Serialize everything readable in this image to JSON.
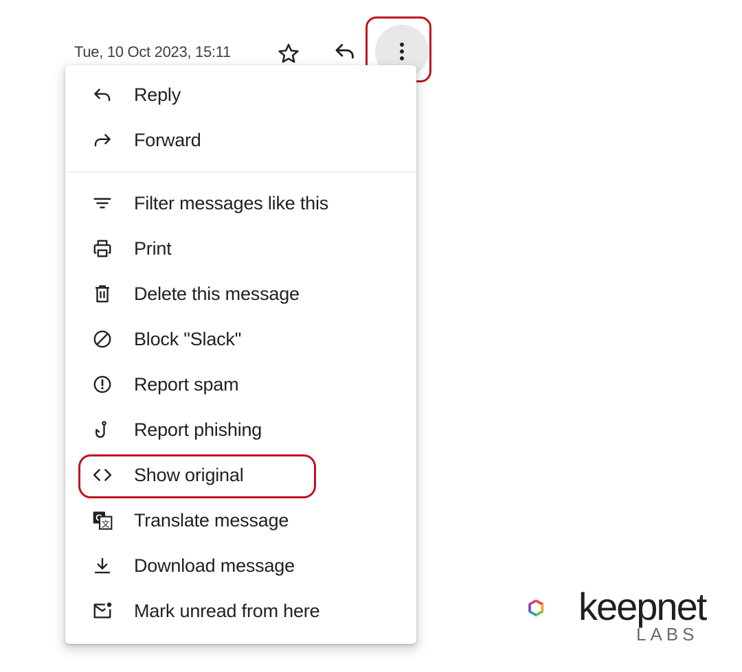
{
  "header": {
    "date": "Tue, 10 Oct 2023, 15:11",
    "star_icon": "star-icon",
    "reply_icon": "reply-icon",
    "more_icon": "more-vert-icon"
  },
  "menu": {
    "items": [
      {
        "label": "Reply",
        "icon": "reply-icon"
      },
      {
        "label": "Forward",
        "icon": "forward-icon"
      },
      {
        "label": "Filter messages like this",
        "icon": "filter-icon"
      },
      {
        "label": "Print",
        "icon": "print-icon"
      },
      {
        "label": "Delete this message",
        "icon": "trash-icon"
      },
      {
        "label": "Block \"Slack\"",
        "icon": "block-icon"
      },
      {
        "label": "Report spam",
        "icon": "report-spam-icon"
      },
      {
        "label": "Report phishing",
        "icon": "phishing-hook-icon"
      },
      {
        "label": "Show original",
        "icon": "code-icon"
      },
      {
        "label": "Translate message",
        "icon": "translate-icon"
      },
      {
        "label": "Download message",
        "icon": "download-icon"
      },
      {
        "label": "Mark unread from here",
        "icon": "mark-unread-icon"
      }
    ]
  },
  "annotation": {
    "highlight_color": "#c0111f"
  },
  "watermark": {
    "brand": "keepnet",
    "sub": "LABS"
  }
}
